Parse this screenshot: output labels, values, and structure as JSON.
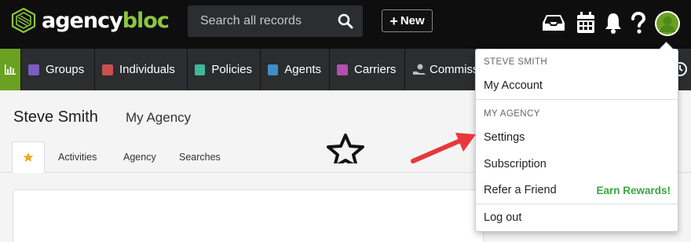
{
  "brand": {
    "name_part1": "agency",
    "name_part2": "bloc",
    "accent": "#8cc63f"
  },
  "search": {
    "placeholder": "Search all records"
  },
  "toolbar": {
    "new_label": "New"
  },
  "nav": {
    "items": [
      {
        "label": "Groups",
        "color": "#7b5cc2"
      },
      {
        "label": "Individuals",
        "color": "#c94f4f"
      },
      {
        "label": "Policies",
        "color": "#3fb89a"
      },
      {
        "label": "Agents",
        "color": "#3f8ec9"
      },
      {
        "label": "Carriers",
        "color": "#b44fb0"
      },
      {
        "label": "Commiss",
        "color": ""
      }
    ]
  },
  "page": {
    "name": "Steve Smith",
    "agency": "My Agency",
    "tabs": [
      "Activities",
      "Agency",
      "Searches"
    ]
  },
  "user_menu": {
    "user_header": "STEVE SMITH",
    "my_account": "My Account",
    "agency_header": "MY AGENCY",
    "settings": "Settings",
    "subscription": "Subscription",
    "refer_friend": "Refer a Friend",
    "earn_rewards": "Earn Rewards!",
    "logout": "Log out"
  },
  "icons": [
    "inbox-icon",
    "calendar-icon",
    "bell-icon",
    "help-icon",
    "search-icon",
    "plus-icon",
    "star-icon",
    "chart-icon"
  ]
}
